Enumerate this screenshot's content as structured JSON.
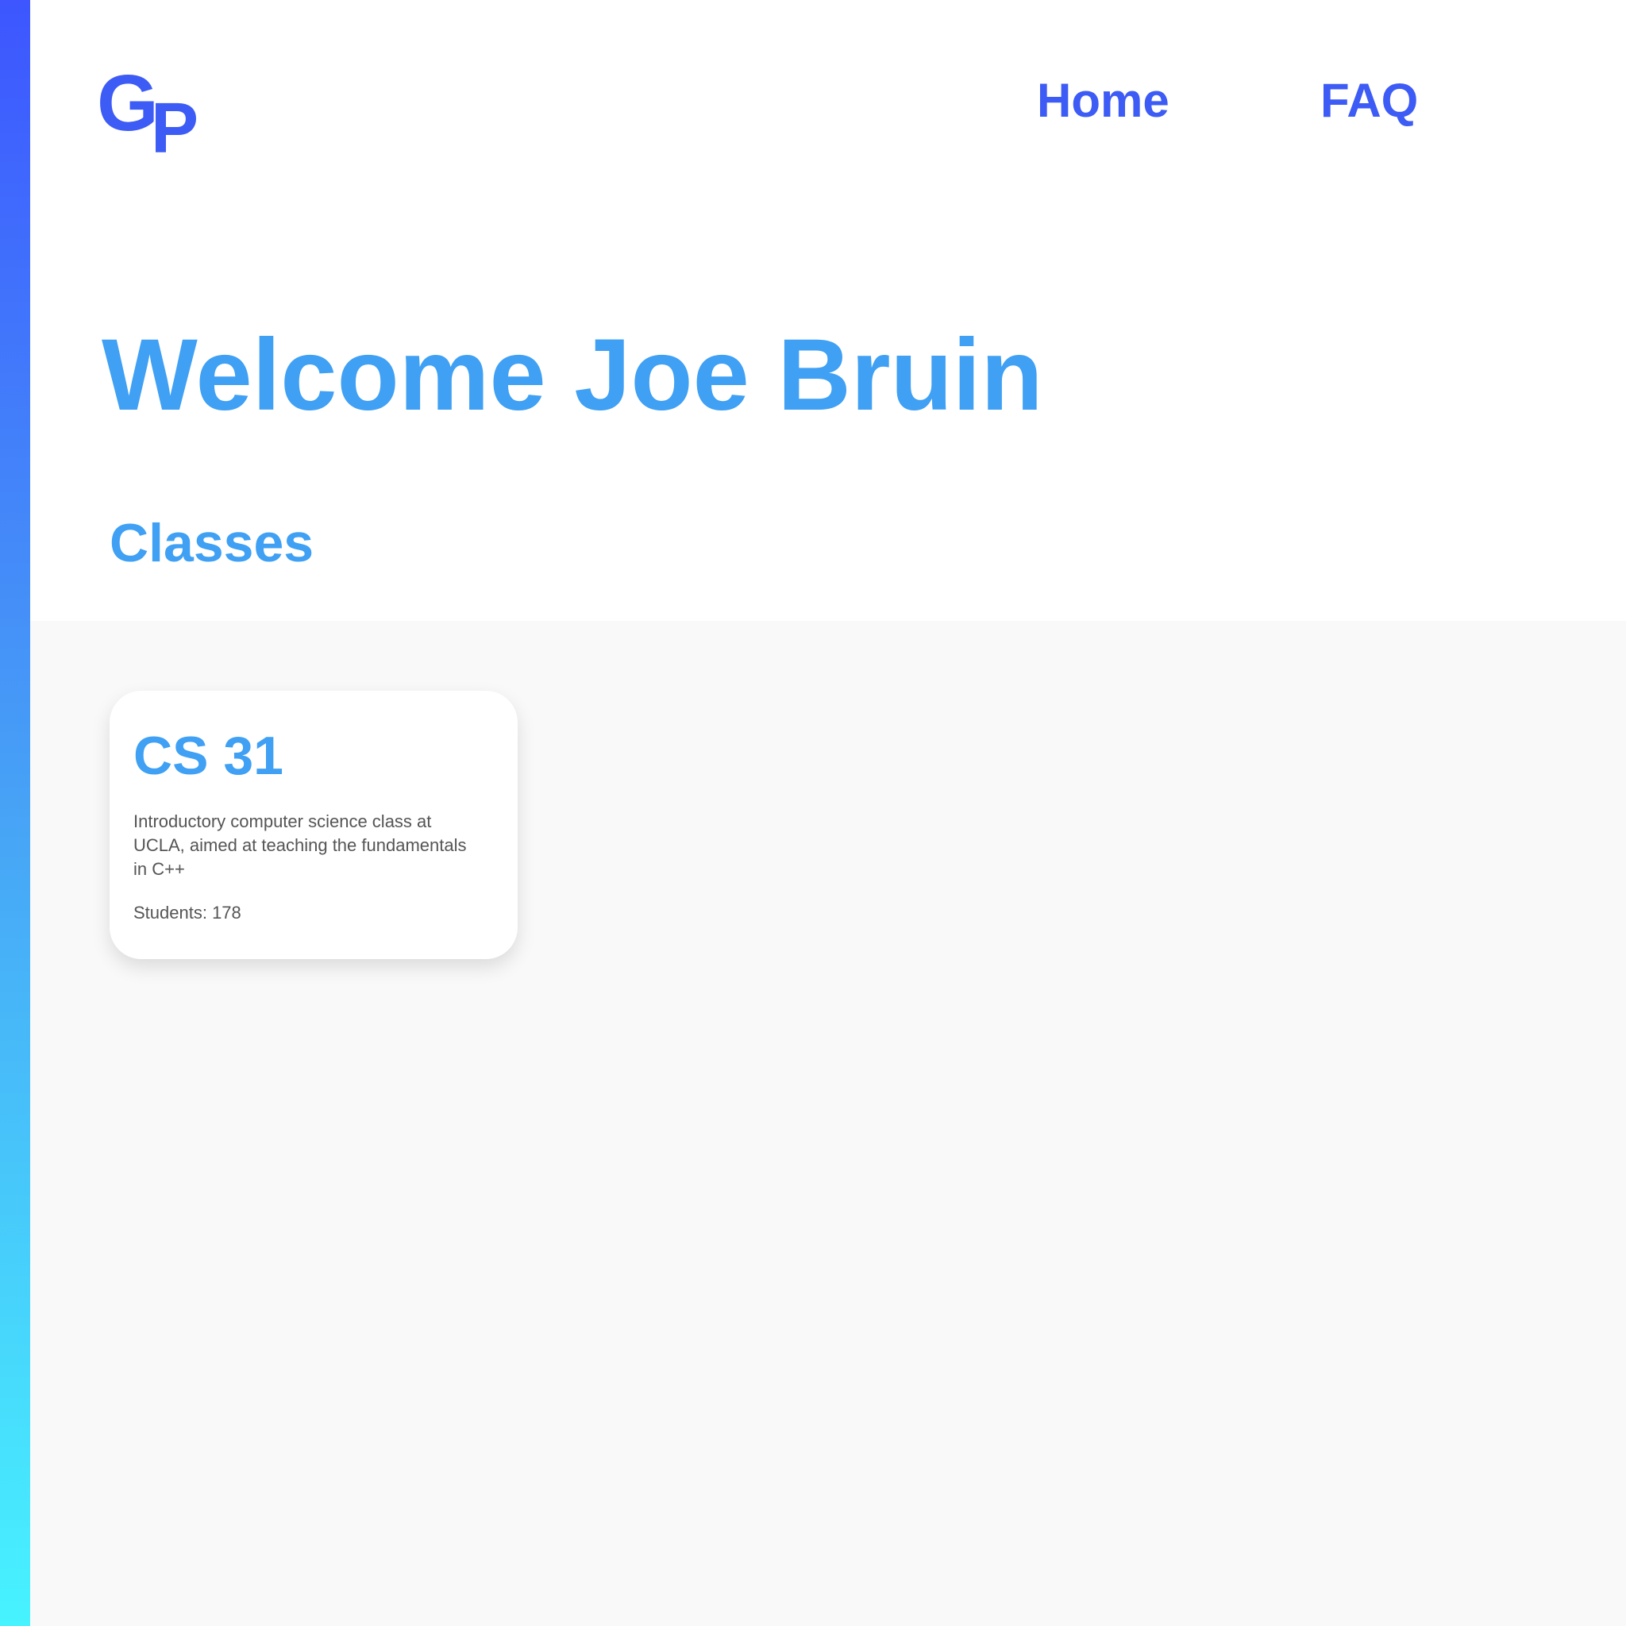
{
  "brand": {
    "logo_letters": [
      "G",
      "P"
    ],
    "accent_color": "#3d5bf5",
    "title_color": "#3fa0f4"
  },
  "nav": {
    "home_label": "Home",
    "faq_label": "FAQ"
  },
  "main": {
    "welcome": "Welcome Joe Bruin",
    "section_title": "Classes",
    "classes": [
      {
        "title": "CS 31",
        "description": "Introductory computer science class at UCLA, aimed at teaching the fundamentals in C++",
        "students": "Students: 178"
      }
    ]
  }
}
